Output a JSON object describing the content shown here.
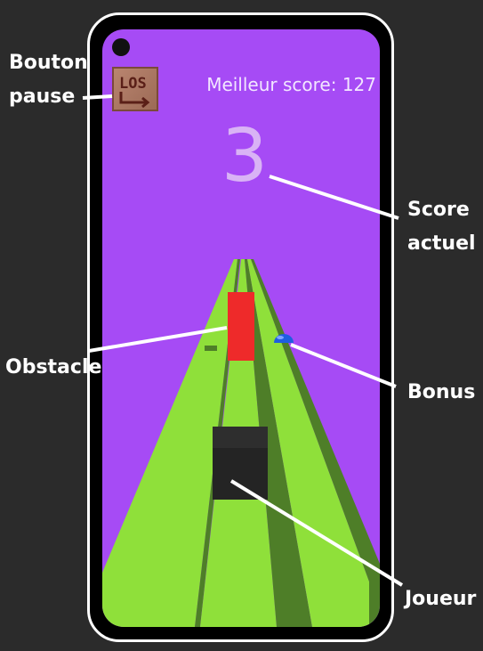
{
  "hud": {
    "best_score_label": "Meilleur score: 127",
    "current_score": "3",
    "pause_icon_text": "LOS"
  },
  "annotations": {
    "pause_line1": "Bouton",
    "pause_line2": "pause",
    "score_line1": "Score",
    "score_line2": "actuel",
    "obstacle": "Obstacle",
    "bonus": "Bonus",
    "player": "Joueur"
  },
  "colors": {
    "sky": "#a64bf5",
    "track": "#8fe03a",
    "track_shadow": "#4e7e28",
    "obstacle": "#ee2a2a",
    "bonus": "#1e5fe0",
    "player": "#242424",
    "background": "#2b2b2b"
  }
}
